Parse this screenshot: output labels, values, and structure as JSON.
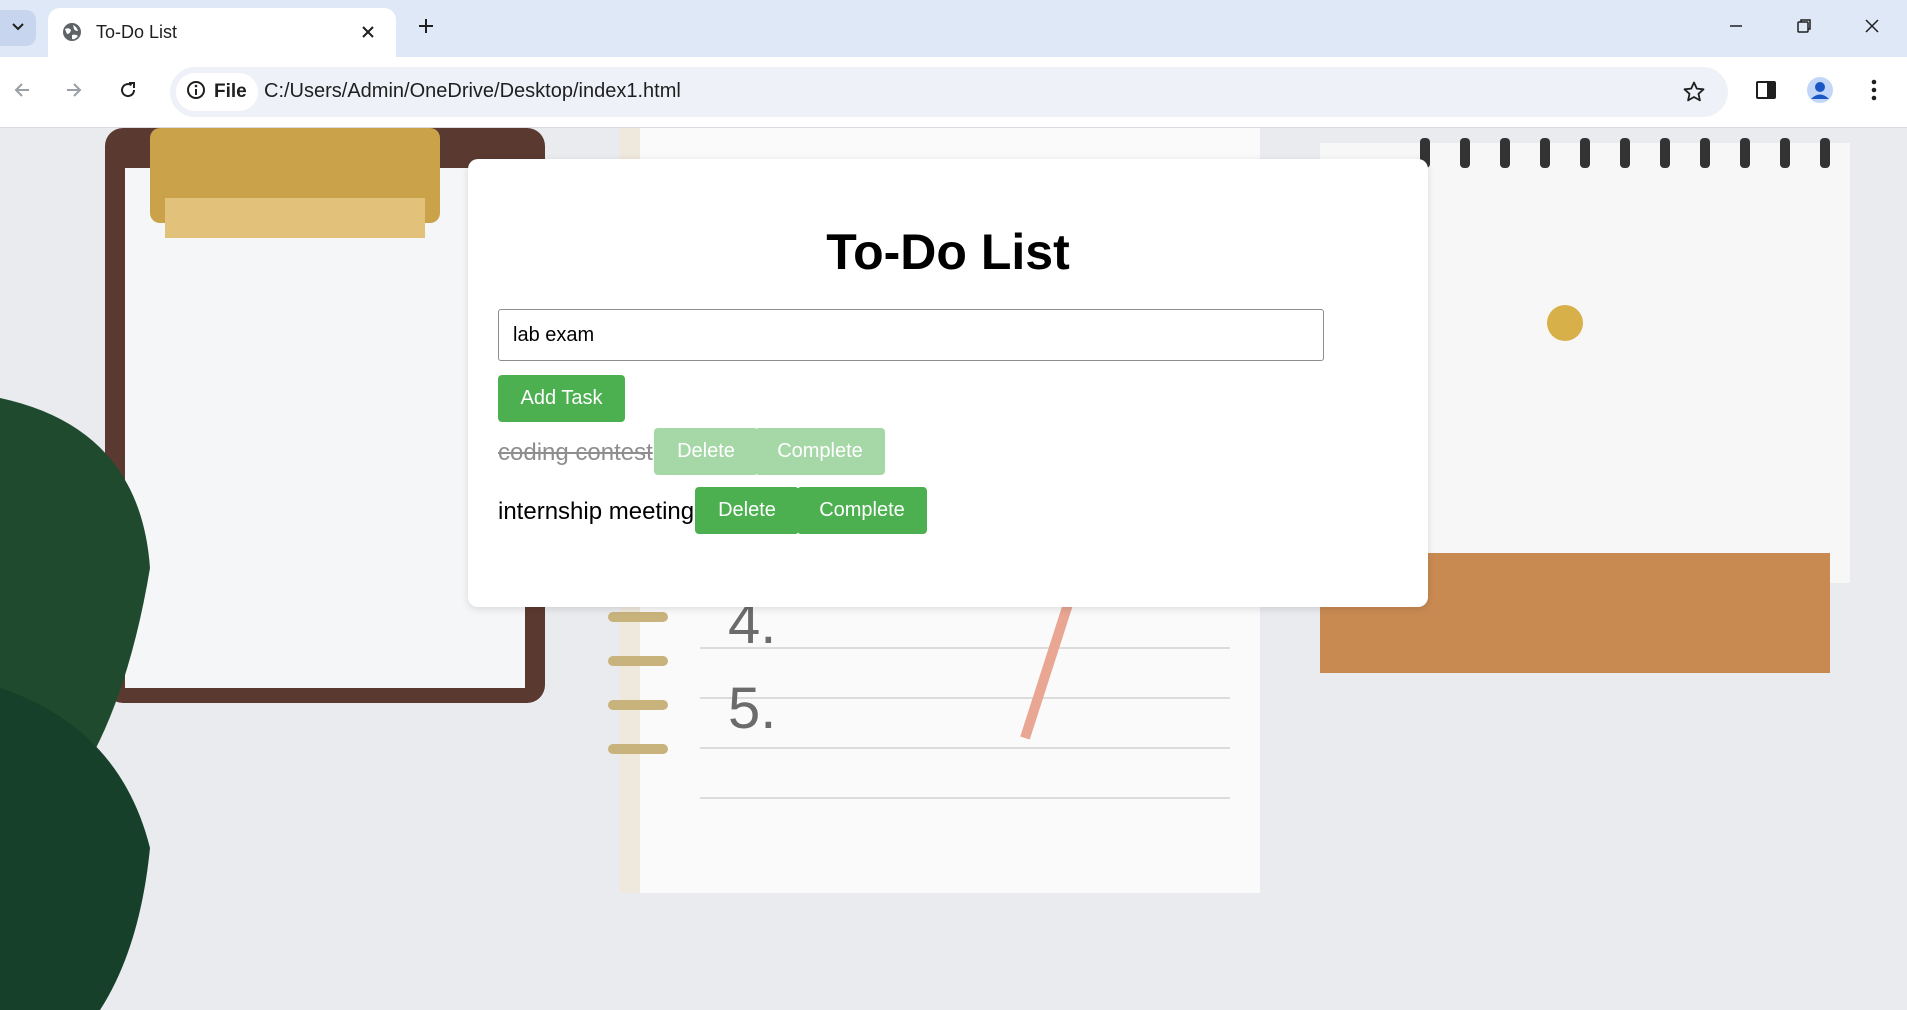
{
  "browser": {
    "tab_title": "To-Do List",
    "site_chip_label": "File",
    "url": "C:/Users/Admin/OneDrive/Desktop/index1.html",
    "icons": [
      "tab-list-icon",
      "globe-icon",
      "close-icon",
      "plus-icon",
      "minimize-icon",
      "restore-icon",
      "window-close-icon",
      "back-icon",
      "forward-icon",
      "reload-icon",
      "info-icon",
      "star-icon",
      "side-panel-icon",
      "profile-icon",
      "menu-icon"
    ]
  },
  "app": {
    "heading": "To-Do List",
    "input_value": "lab exam",
    "add_button_label": "Add Task",
    "tasks": [
      {
        "text": "coding contest",
        "completed": true,
        "delete_label": "Delete",
        "complete_label": "Complete"
      },
      {
        "text": "internship meeting",
        "completed": false,
        "delete_label": "Delete",
        "complete_label": "Complete"
      }
    ]
  },
  "colors": {
    "button_green": "#4caf50",
    "button_green_faded": "#a5d7a7",
    "tabbar_bg": "#dfe8f6"
  }
}
